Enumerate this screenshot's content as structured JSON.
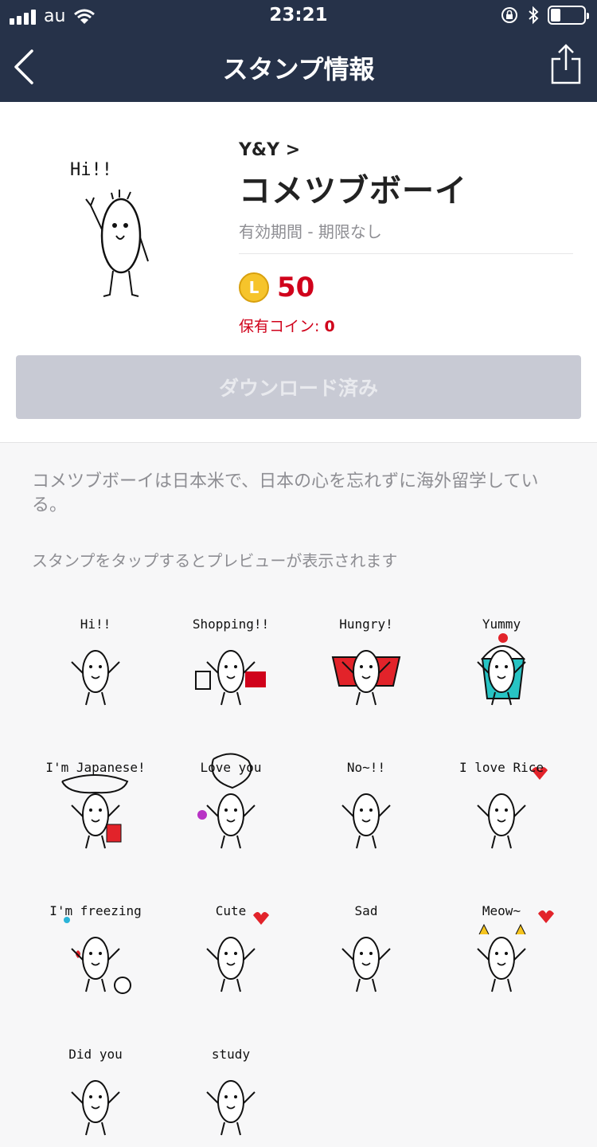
{
  "status_bar": {
    "carrier": "au",
    "time": "23:21"
  },
  "nav": {
    "title": "スタンプ情報"
  },
  "pack": {
    "author": "Y&Y",
    "name": "コメツブボーイ",
    "validity": "有効期間 - 期限なし",
    "coin_symbol": "L",
    "price": "50",
    "owned_label": "保有コイン: ",
    "owned_value": "0",
    "download_label": "ダウンロード済み"
  },
  "description": "コメツブボーイは日本米で、日本の心を忘れずに海外留学している。",
  "preview_hint": "スタンプをタップするとプレビューが表示されます",
  "stickers": [
    {
      "text": "Hi!!"
    },
    {
      "text": "Shopping!!"
    },
    {
      "text": "Hungry!"
    },
    {
      "text": "Yummy"
    },
    {
      "text": "I'm Japanese!"
    },
    {
      "text": "Love you"
    },
    {
      "text": "No~!!"
    },
    {
      "text": "I love Rice"
    },
    {
      "text": "I'm freezing"
    },
    {
      "text": "Cute"
    },
    {
      "text": "Sad"
    },
    {
      "text": "Meow~"
    },
    {
      "text": "Did you"
    },
    {
      "text": "study"
    }
  ],
  "colors": {
    "nav_bg": "#263249",
    "price_red": "#d0021b",
    "coin_gold": "#f6c42b",
    "button_disabled": "#c8cad4"
  }
}
